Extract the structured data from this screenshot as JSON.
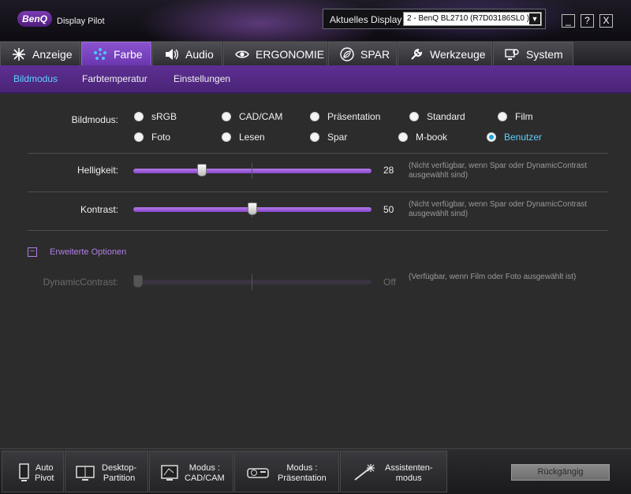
{
  "app": {
    "logo": "BenQ",
    "title": "Display Pilot"
  },
  "display": {
    "label": "Aktuelles Display",
    "selected": "2 - BenQ BL2710 (R7D03186SL0 )"
  },
  "window_controls": {
    "minimize": "_",
    "help": "?",
    "close": "X"
  },
  "tabs": [
    {
      "label": "Anzeige",
      "icon": "sparkle-icon"
    },
    {
      "label": "Farbe",
      "icon": "palette-icon",
      "active": true
    },
    {
      "label": "Audio",
      "icon": "speaker-icon"
    },
    {
      "label": "ERGONOMIE",
      "icon": "eye-icon"
    },
    {
      "label": "SPAR",
      "icon": "leaf-icon"
    },
    {
      "label": "Werkzeuge",
      "icon": "wrench-icon"
    },
    {
      "label": "System",
      "icon": "monitor-gear-icon"
    }
  ],
  "subtabs": [
    {
      "label": "Bildmodus",
      "active": true
    },
    {
      "label": "Farbtemperatur"
    },
    {
      "label": "Einstellungen"
    }
  ],
  "bildmodus": {
    "label": "Bildmodus:",
    "options": [
      "sRGB",
      "CAD/CAM",
      "Präsentation",
      "Standard",
      "Film",
      "Foto",
      "Lesen",
      "Spar",
      "M-book",
      "Benutzer"
    ],
    "selected": "Benutzer"
  },
  "helligkeit": {
    "label": "Helligkeit:",
    "value": "28",
    "level": 28,
    "note": "(Nicht verfügbar, wenn Spar oder DynamicContrast ausgewählt sind)"
  },
  "kontrast": {
    "label": "Kontrast:",
    "value": "50",
    "level": 50,
    "note": "(Nicht verfügbar, wenn Spar oder DynamicContrast ausgewählt sind)"
  },
  "advanced": {
    "toggle": "−",
    "label": "Erweiterte Optionen",
    "dynamic_label": "DynamicContrast:",
    "dynamic_value": "Off",
    "dynamic_level": 0,
    "dynamic_note": "(Verfügbar, wenn Film oder Foto ausgewählt ist)"
  },
  "bottom": {
    "buttons": [
      {
        "label": "Auto\nPivot",
        "icon": "monitor-pivot-icon"
      },
      {
        "label": "Desktop-\nPartition",
        "icon": "monitor-partition-icon"
      },
      {
        "label": "Modus :\nCAD/CAM",
        "icon": "cad-icon"
      },
      {
        "label": "Modus :\nPräsentation",
        "icon": "projector-icon"
      },
      {
        "label": "Assistenten-\nmodus",
        "icon": "magic-wand-icon"
      }
    ],
    "undo": "Rückgängig"
  },
  "colors": {
    "accent": "#7a44c2",
    "selected_text": "#5ed0ff"
  }
}
